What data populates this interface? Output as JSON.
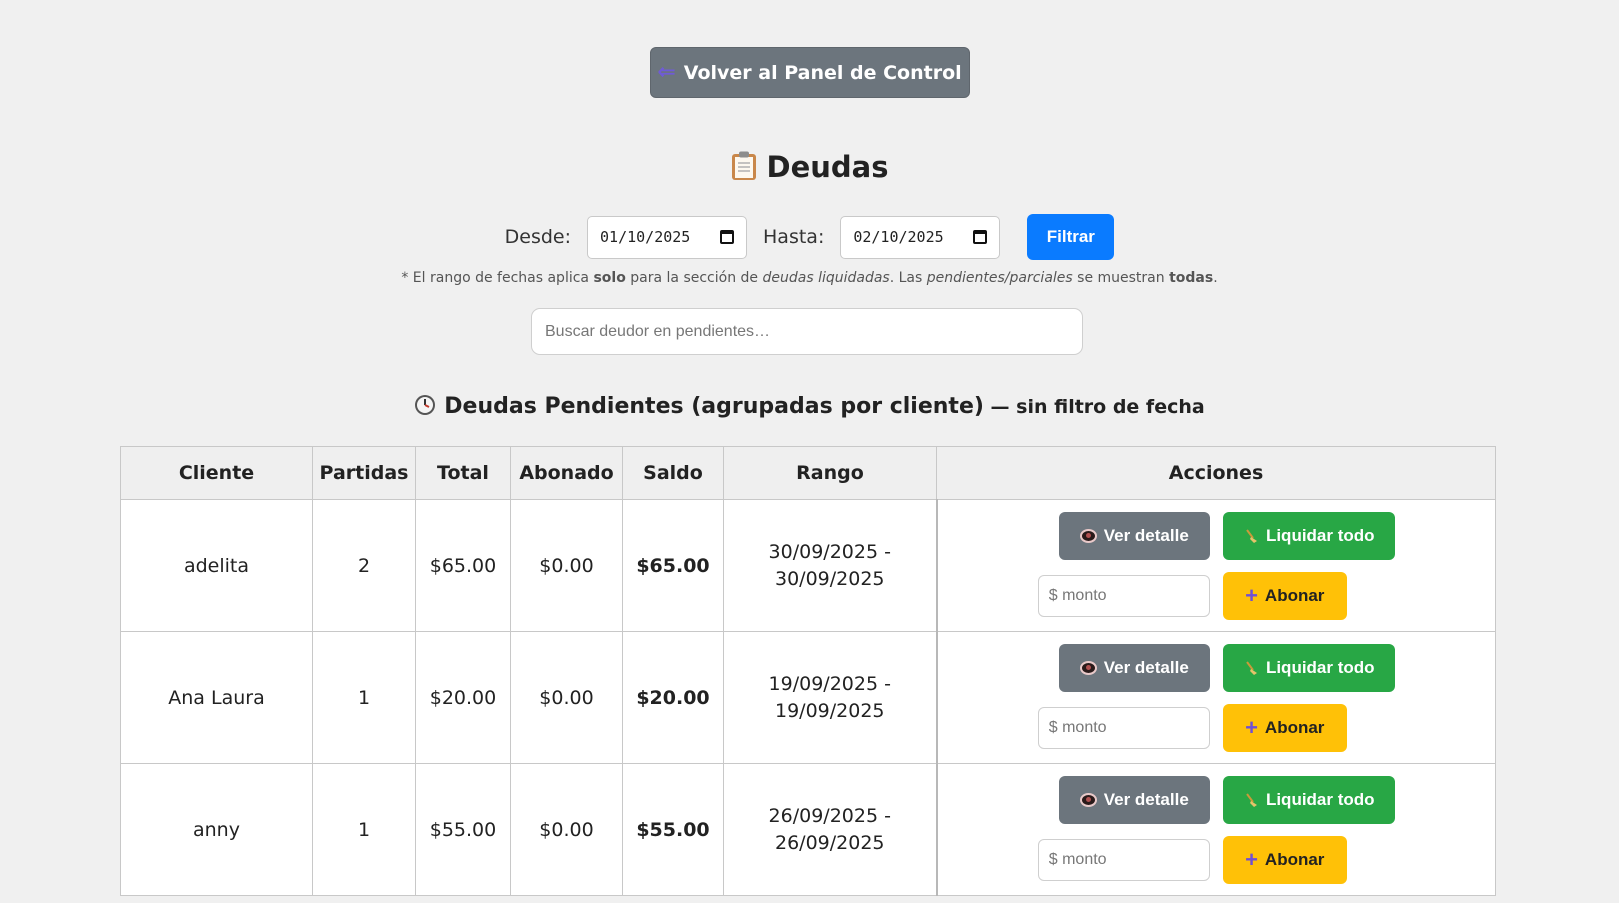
{
  "header": {
    "back_label": "Volver al Panel de Control",
    "back_icon": "left-arrow-icon",
    "title": "Deudas",
    "title_icon": "clipboard-icon"
  },
  "filter": {
    "desde_label": "Desde:",
    "desde_value": "01/10/2025",
    "hasta_label": "Hasta:",
    "hasta_value": "02/10/2025",
    "filter_button": "Filtrar"
  },
  "note": {
    "p1": "* El rango de fechas aplica ",
    "b1": "solo",
    "p2": " para la sección de ",
    "i1": "deudas liquidadas",
    "p3": ". Las ",
    "i2": "pendientes/parciales",
    "p4": " se muestran ",
    "b2": "todas",
    "p5": "."
  },
  "search": {
    "placeholder": "Buscar deudor en pendientes…"
  },
  "section": {
    "title": "Deudas Pendientes (agrupadas por cliente)",
    "subtitle": " — sin filtro de fecha",
    "icon": "clock-icon"
  },
  "table": {
    "headers": [
      "Cliente",
      "Partidas",
      "Total",
      "Abonado",
      "Saldo",
      "Rango",
      "Acciones"
    ],
    "rows": [
      {
        "cliente": "adelita",
        "partidas": "2",
        "total": "$65.00",
        "abonado": "$0.00",
        "saldo": "$65.00",
        "rango_a": "30/09/2025 -",
        "rango_b": "30/09/2025"
      },
      {
        "cliente": "Ana Laura",
        "partidas": "1",
        "total": "$20.00",
        "abonado": "$0.00",
        "saldo": "$20.00",
        "rango_a": "19/09/2025 -",
        "rango_b": "19/09/2025"
      },
      {
        "cliente": "anny",
        "partidas": "1",
        "total": "$55.00",
        "abonado": "$0.00",
        "saldo": "$55.00",
        "rango_a": "26/09/2025 -",
        "rango_b": "26/09/2025"
      }
    ],
    "actions": {
      "detail_label": "Ver detalle",
      "liquidar_label": "Liquidar todo",
      "monto_placeholder": "$ monto",
      "abonar_label": "Abonar"
    }
  },
  "colors": {
    "background": "#f0f0f0",
    "back_button": "#6c757d",
    "filter_button": "#0a7bff",
    "detail_button": "#6c757d",
    "liquidar_button": "#28a745",
    "abonar_button": "#ffc107"
  }
}
